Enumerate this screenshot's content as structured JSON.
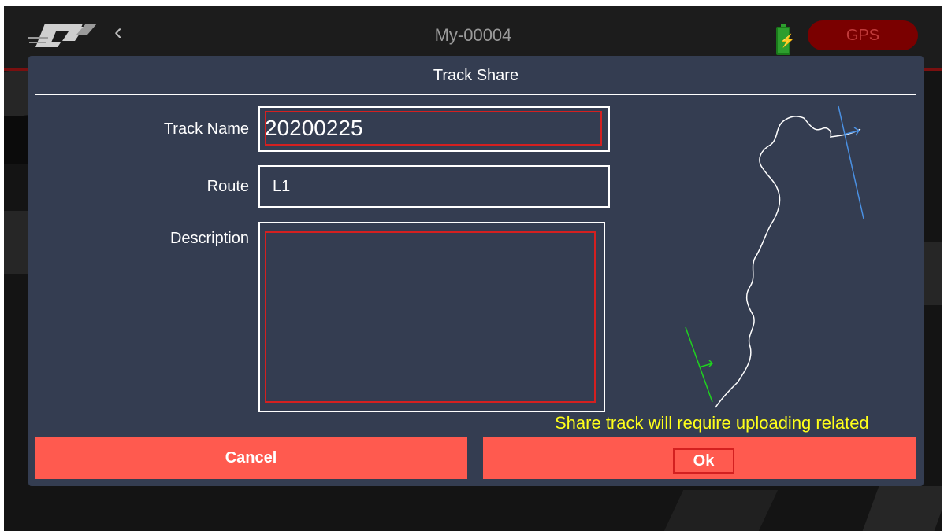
{
  "app": {
    "title": "My-00004",
    "gps_label": "GPS"
  },
  "dialog": {
    "title": "Track Share",
    "fields": {
      "track_name_label": "Track Name",
      "track_name_value": "20200225",
      "route_label": "Route",
      "route_value": "L1",
      "description_label": "Description",
      "description_value": ""
    },
    "warning": "Share track will require uploading related",
    "cancel_label": "Cancel",
    "ok_label": "Ok"
  },
  "icons": {
    "back": "chevron-left-icon",
    "battery": "battery-charging-icon",
    "logo": "rc-logo"
  },
  "colors": {
    "accent": "#ff5a4f",
    "dialog_bg": "#343d51",
    "warning": "#ffff1a",
    "start_line": "#1fd11f",
    "finish_line": "#4a90e2"
  }
}
